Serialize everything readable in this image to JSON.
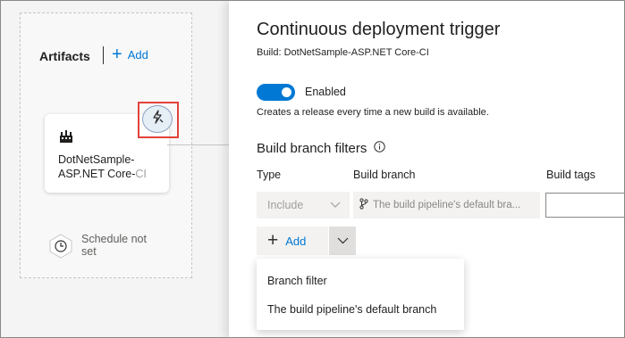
{
  "artifacts": {
    "title": "Artifacts",
    "add_label": "Add",
    "artifact_name": "DotNetSample-ASP.NET Core-",
    "artifact_name_faded": "CI",
    "schedule_label": "Schedule not set"
  },
  "panel": {
    "title": "Continuous deployment trigger",
    "subtitle": "Build: DotNetSample-ASP.NET Core-CI",
    "toggle_label": "Enabled",
    "toggle_on": true,
    "toggle_description": "Creates a release every time a new build is available.",
    "filters_title": "Build branch filters",
    "columns": {
      "type": "Type",
      "branch": "Build branch",
      "tags": "Build tags"
    },
    "type_value": "Include",
    "branch_value": "The build pipeline's default bra...",
    "tags_value": "",
    "add_label": "Add",
    "menu_items": [
      "Branch filter",
      "The build pipeline's default branch"
    ]
  },
  "colors": {
    "accent": "#0078d4",
    "highlight": "#e3423a"
  },
  "icons": [
    "plus-icon",
    "build-pipeline-icon",
    "lightning-trigger-icon",
    "clock-icon",
    "info-icon",
    "branch-icon",
    "chevron-down-icon"
  ]
}
